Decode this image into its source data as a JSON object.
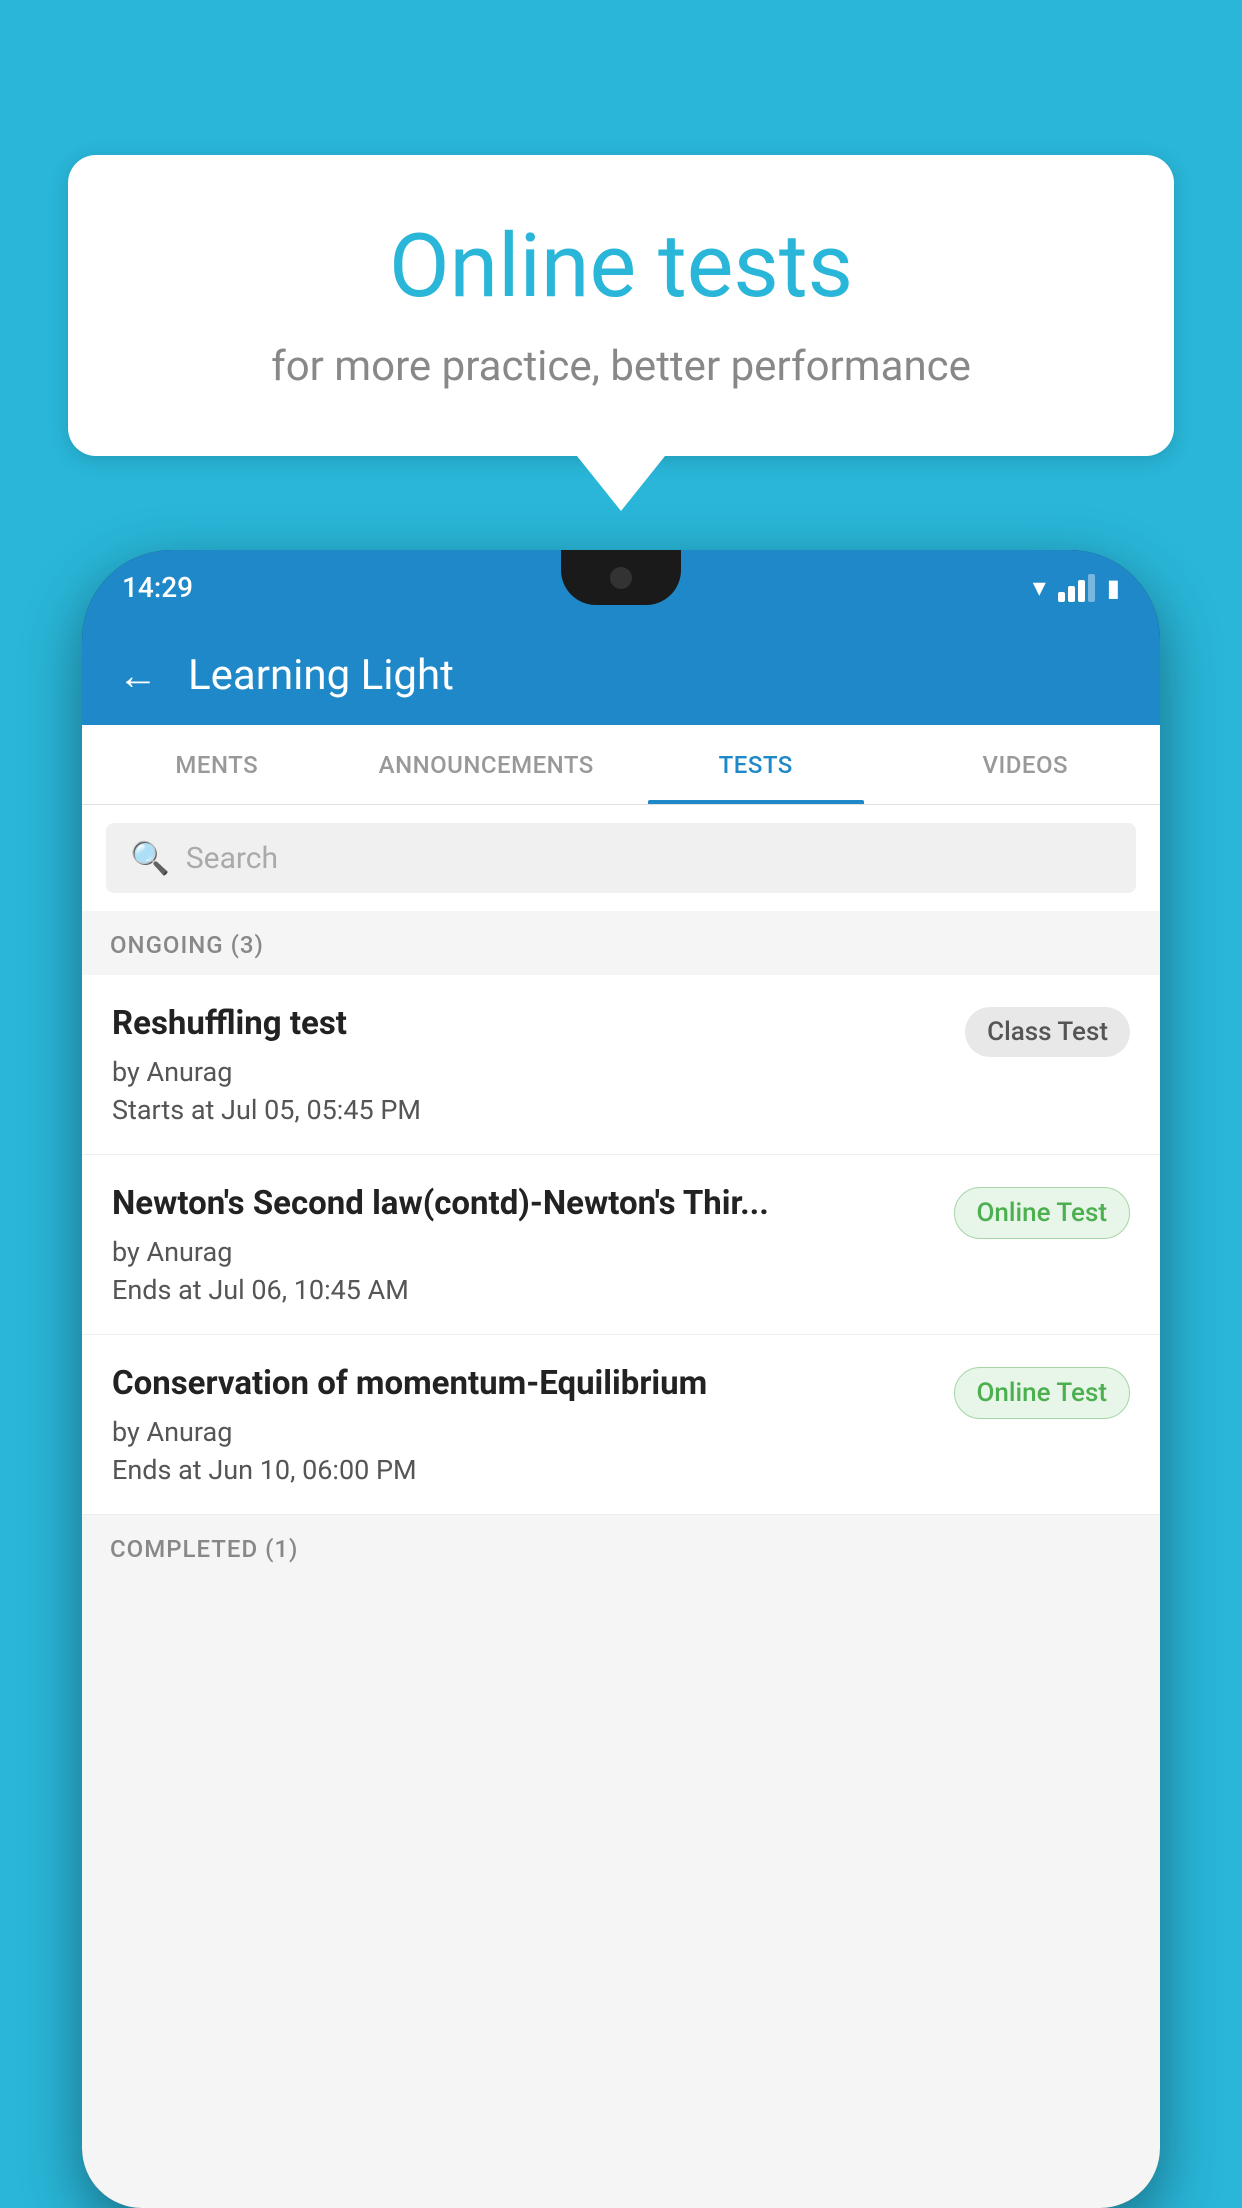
{
  "background_color": "#29b6d8",
  "speech_bubble": {
    "title": "Online tests",
    "subtitle": "for more practice, better performance"
  },
  "status_bar": {
    "time": "14:29"
  },
  "app_header": {
    "title": "Learning Light",
    "back_label": "←"
  },
  "tabs": [
    {
      "label": "MENTS",
      "active": false
    },
    {
      "label": "ANNOUNCEMENTS",
      "active": false
    },
    {
      "label": "TESTS",
      "active": true
    },
    {
      "label": "VIDEOS",
      "active": false
    }
  ],
  "search": {
    "placeholder": "Search"
  },
  "ongoing_section": {
    "label": "ONGOING (3)"
  },
  "tests": [
    {
      "name": "Reshuffling test",
      "by": "by Anurag",
      "date": "Starts at  Jul 05, 05:45 PM",
      "badge": "Class Test",
      "badge_type": "class"
    },
    {
      "name": "Newton's Second law(contd)-Newton's Thir...",
      "by": "by Anurag",
      "date": "Ends at  Jul 06, 10:45 AM",
      "badge": "Online Test",
      "badge_type": "online"
    },
    {
      "name": "Conservation of momentum-Equilibrium",
      "by": "by Anurag",
      "date": "Ends at  Jun 10, 06:00 PM",
      "badge": "Online Test",
      "badge_type": "online"
    }
  ],
  "completed_section": {
    "label": "COMPLETED (1)"
  }
}
